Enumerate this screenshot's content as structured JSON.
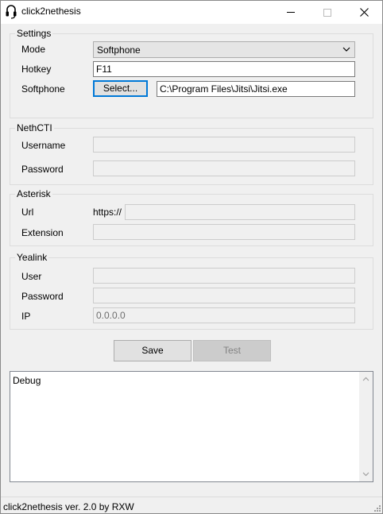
{
  "window": {
    "title": "click2nethesis",
    "minimize_icon": "minimize-icon",
    "maximize_icon": "maximize-icon",
    "close_icon": "close-icon",
    "app_icon": "headset-icon"
  },
  "settings": {
    "legend": "Settings",
    "mode_label": "Mode",
    "mode_value": "Softphone",
    "hotkey_label": "Hotkey",
    "hotkey_value": "F11",
    "softphone_label": "Softphone",
    "select_button": "Select...",
    "softphone_path": "C:\\Program Files\\Jitsi\\Jitsi.exe"
  },
  "nethcti": {
    "legend": "NethCTI",
    "username_label": "Username",
    "username_value": "",
    "password_label": "Password",
    "password_value": ""
  },
  "asterisk": {
    "legend": "Asterisk",
    "url_label": "Url",
    "url_prefix": "https://",
    "url_value": "",
    "extension_label": "Extension",
    "extension_value": ""
  },
  "yealink": {
    "legend": "Yealink",
    "user_label": "User",
    "user_value": "",
    "password_label": "Password",
    "password_value": "",
    "ip_label": "IP",
    "ip_value": "0.0.0.0"
  },
  "actions": {
    "save_label": "Save",
    "test_label": "Test"
  },
  "debug": {
    "text": "Debug"
  },
  "status": {
    "text": "click2nethesis ver. 2.0 by RXW"
  }
}
